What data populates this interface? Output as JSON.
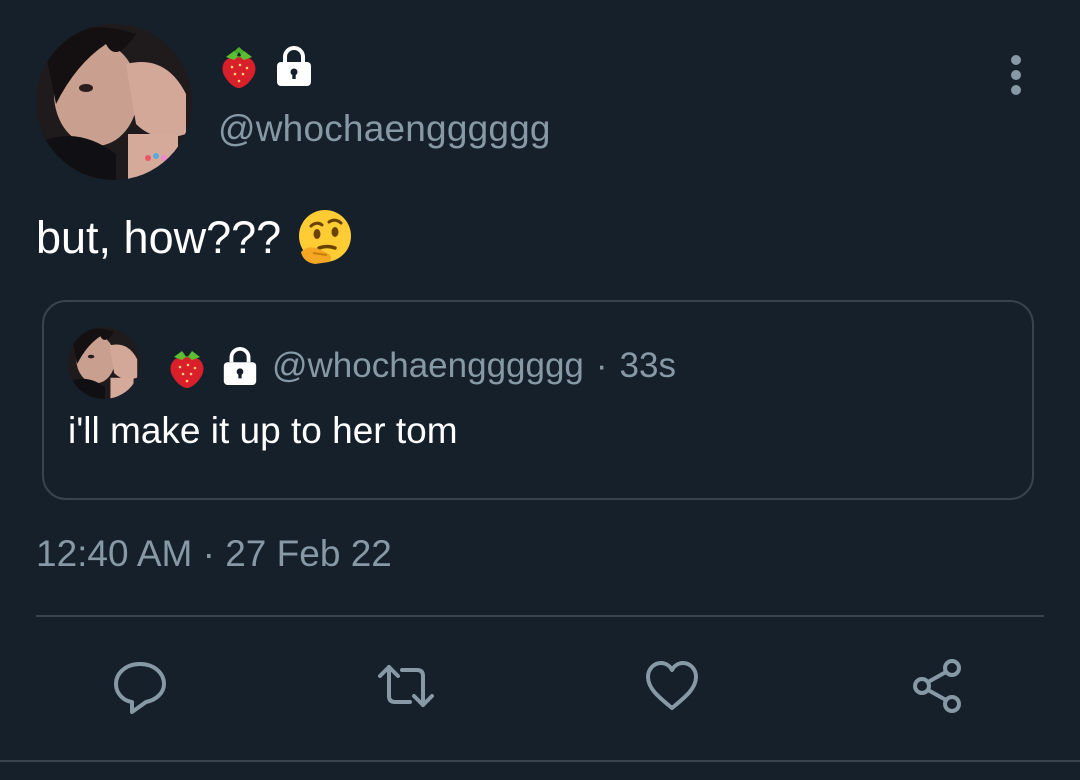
{
  "header": {
    "handle": "@whochaengggggg",
    "name_icons": [
      "strawberry-emoji",
      "lock-icon"
    ],
    "more_icon": "vertical-dots-icon"
  },
  "tweet": {
    "text": "but, how???",
    "emoji": "thinking-face-emoji",
    "timestamp_time": "12:40 AM",
    "timestamp_sep": "·",
    "timestamp_date": "27 Feb 22"
  },
  "quote": {
    "handle": "@whochaengggggg",
    "separator": "·",
    "age": "33s",
    "text": "i'll make it up to her tom"
  },
  "actions": [
    {
      "name": "reply",
      "icon": "reply-icon"
    },
    {
      "name": "retweet",
      "icon": "retweet-icon"
    },
    {
      "name": "like",
      "icon": "heart-icon"
    },
    {
      "name": "share",
      "icon": "share-icon"
    }
  ],
  "colors": {
    "background": "#15202b",
    "secondary_text": "#8899a6",
    "border": "#38444d",
    "primary_text": "#ffffff"
  }
}
